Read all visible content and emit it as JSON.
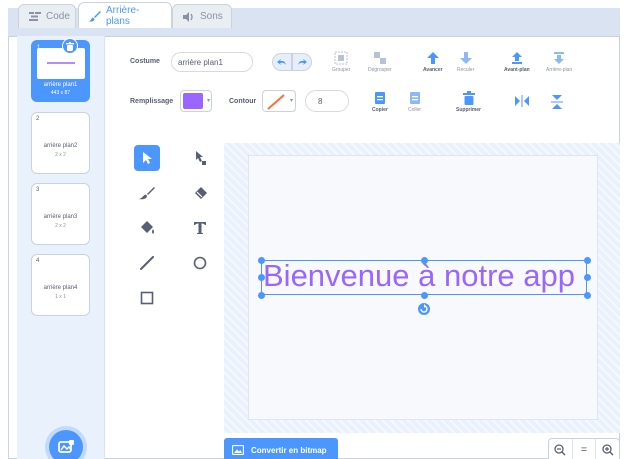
{
  "tabs": [
    {
      "label": "Code",
      "icon": "code-icon",
      "active": false
    },
    {
      "label": "Arrière-plans",
      "icon": "brush-icon",
      "active": true
    },
    {
      "label": "Sons",
      "icon": "sound-icon",
      "active": false
    }
  ],
  "costumes": [
    {
      "num": "1",
      "name": "arrière plan1",
      "size": "443 x 87",
      "selected": true
    },
    {
      "num": "2",
      "name": "arrière plan2",
      "size": "2 x 2",
      "selected": false
    },
    {
      "num": "3",
      "name": "arrière plan3",
      "size": "2 x 2",
      "selected": false
    },
    {
      "num": "4",
      "name": "arrière plan4",
      "size": "1 x 1",
      "selected": false
    }
  ],
  "toolbar": {
    "costume_label": "Costume",
    "costume_name": "arrière plan1",
    "group_label": "Grouper",
    "ungroup_label": "Dégrouper",
    "forward_label": "Avancer",
    "backward_label": "Reculer",
    "front_label": "Avant-plan",
    "back_label": "Arrière-plan",
    "fill_label": "Remplissage",
    "fill_color": "#9966ff",
    "outline_label": "Contour",
    "outline_size": "8",
    "copy_label": "Copier",
    "paste_label": "Coller",
    "delete_label": "Supprimer"
  },
  "canvas": {
    "text": "Bienvenue à notre app",
    "text_color": "#9966ff",
    "selection_color": "#4c97ff"
  },
  "bottom": {
    "convert_label": "Convertir en bitmap",
    "zoom_out": "−",
    "zoom_reset": "=",
    "zoom_in": "+"
  },
  "colors": {
    "accent": "#4c97ff",
    "text": "#575e75"
  }
}
